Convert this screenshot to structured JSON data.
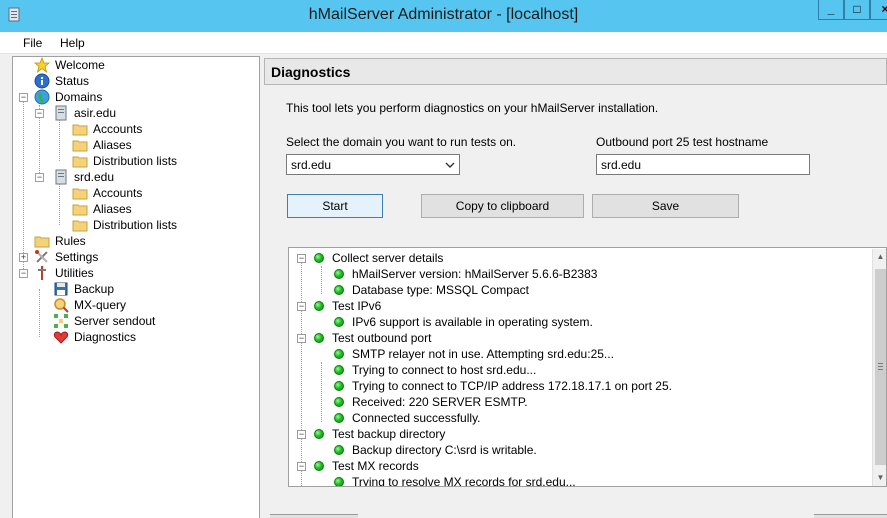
{
  "window": {
    "title": "hMailServer Administrator - [localhost]",
    "controls": {
      "minimize": "_",
      "maximize": "□",
      "close": "×"
    }
  },
  "menu": {
    "file": "File",
    "help": "Help"
  },
  "tree": {
    "welcome": "Welcome",
    "status": "Status",
    "domains": "Domains",
    "domain1": "asir.edu",
    "domain1_accounts": "Accounts",
    "domain1_aliases": "Aliases",
    "domain1_distribution": "Distribution lists",
    "domain2": "srd.edu",
    "domain2_accounts": "Accounts",
    "domain2_aliases": "Aliases",
    "domain2_distribution": "Distribution lists",
    "rules": "Rules",
    "settings": "Settings",
    "utilities": "Utilities",
    "backup": "Backup",
    "mx_query": "MX-query",
    "server_sendout": "Server sendout",
    "diagnostics": "Diagnostics"
  },
  "main": {
    "header": "Diagnostics",
    "intro": "This tool lets you perform diagnostics on your hMailServer installation.",
    "domain_label": "Select the domain you want to run tests on.",
    "domain_value": "srd.edu",
    "hostname_label": "Outbound port 25 test hostname",
    "hostname_value": "srd.edu",
    "start_button": "Start",
    "copy_button": "Copy to clipboard",
    "save_button": "Save"
  },
  "results": {
    "collect": "Collect server details",
    "version": "hMailServer version: hMailServer 5.6.6-B2383",
    "dbtype": "Database type: MSSQL Compact",
    "ipv6": "Test IPv6",
    "ipv6_support": "IPv6 support is available in operating system.",
    "outbound": "Test outbound port",
    "smtp_relayer": "SMTP relayer not in use. Attempting srd.edu:25...",
    "connect_host": "Trying to connect to host srd.edu...",
    "connect_tcp": "Trying to connect to TCP/IP address 172.18.17.1 on port 25.",
    "received": "Received: 220 SERVER ESMTP.",
    "connected": "Connected successfully.",
    "backup_dir": "Test backup directory",
    "backup_writable": "Backup directory C:\\srd is writable.",
    "mx": "Test MX records",
    "mx_resolve": "Trying to resolve MX records for srd.edu..."
  },
  "colors": {
    "titlebar": "#56c5f0",
    "status_ok": "#22c022",
    "button_primary_border": "#3c7fb1"
  }
}
